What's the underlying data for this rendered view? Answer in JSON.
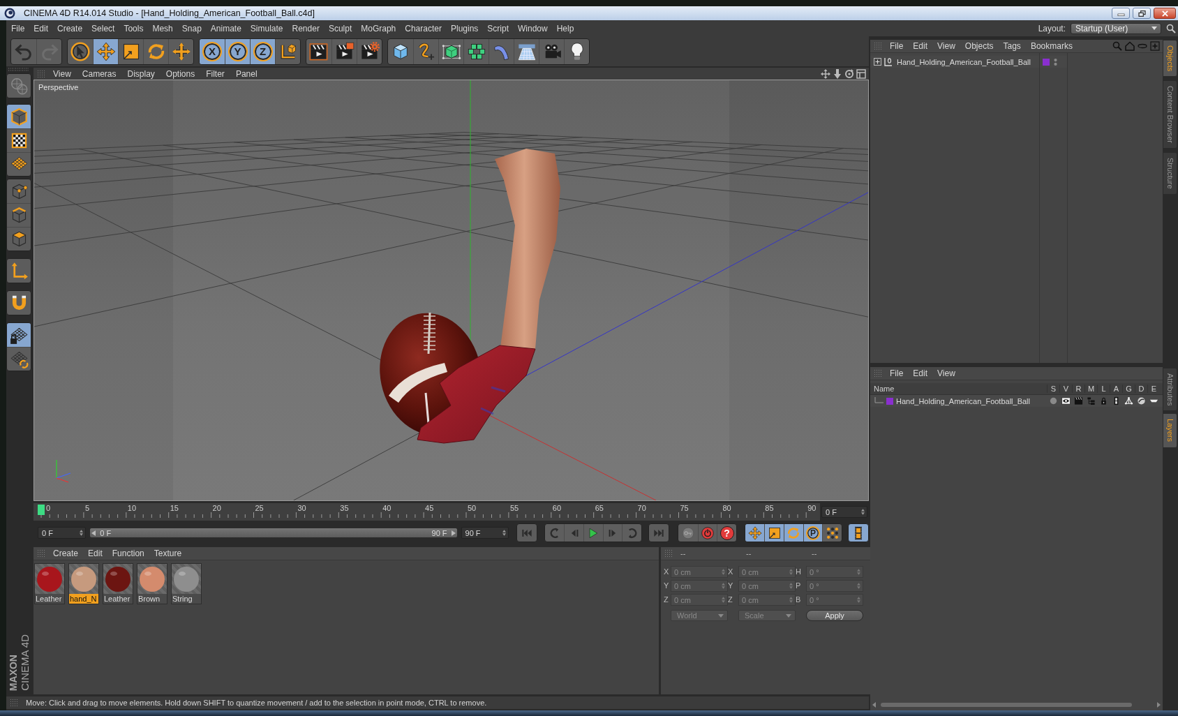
{
  "window": {
    "title": "CINEMA 4D R14.014 Studio - [Hand_Holding_American_Football_Ball.c4d]"
  },
  "menu_bar": [
    "File",
    "Edit",
    "Create",
    "Select",
    "Tools",
    "Mesh",
    "Snap",
    "Animate",
    "Simulate",
    "Render",
    "Sculpt",
    "MoGraph",
    "Character",
    "Plugins",
    "Script",
    "Window",
    "Help"
  ],
  "layout": {
    "label": "Layout:",
    "value": "Startup (User)"
  },
  "toolbar": [
    [
      {
        "kind": "undo",
        "selected": false
      },
      {
        "kind": "redo",
        "selected": false
      }
    ],
    [
      {
        "kind": "live_select",
        "selected": false
      },
      {
        "kind": "move",
        "selected": true
      },
      {
        "kind": "scale",
        "selected": false
      },
      {
        "kind": "rotate",
        "selected": false
      },
      {
        "kind": "recent_tools",
        "selected": false
      }
    ],
    [
      {
        "kind": "axis_lock",
        "label": "X",
        "selected": true
      },
      {
        "kind": "axis_lock",
        "label": "Y",
        "selected": true
      },
      {
        "kind": "axis_lock",
        "label": "Z",
        "selected": true
      },
      {
        "kind": "coordinate_system",
        "selected": false
      }
    ],
    [
      {
        "kind": "render_view",
        "selected": false
      },
      {
        "kind": "render_viewer",
        "selected": false
      },
      {
        "kind": "render_settings",
        "selected": false
      }
    ],
    [
      {
        "kind": "cube",
        "selected": false
      },
      {
        "kind": "spline",
        "selected": false
      },
      {
        "kind": "subdivision",
        "selected": false
      },
      {
        "kind": "cloner",
        "selected": false
      },
      {
        "kind": "deformer",
        "selected": false
      },
      {
        "kind": "floor",
        "selected": false
      },
      {
        "kind": "camera",
        "selected": false
      },
      {
        "kind": "light",
        "selected": false
      }
    ]
  ],
  "mode_tools": [
    [
      {
        "kind": "make_editable",
        "selected": false
      }
    ],
    [
      {
        "kind": "model",
        "selected": true
      },
      {
        "kind": "texture",
        "selected": false
      },
      {
        "kind": "workplane",
        "selected": false
      }
    ],
    [
      {
        "kind": "points",
        "selected": false
      },
      {
        "kind": "edges",
        "selected": false
      },
      {
        "kind": "polygons",
        "selected": false
      }
    ],
    [
      {
        "kind": "axis",
        "selected": false
      }
    ],
    [
      {
        "kind": "snap",
        "selected": false
      }
    ],
    [
      {
        "kind": "workplane_lock",
        "selected": true
      },
      {
        "kind": "workplane_rotate",
        "selected": false
      }
    ]
  ],
  "brand": {
    "line_1": "MAXON",
    "line_2": "CINEMA 4D"
  },
  "viewport": {
    "menu": [
      "View",
      "Cameras",
      "Display",
      "Options",
      "Filter",
      "Panel"
    ],
    "camera_label": "Perspective"
  },
  "timeline": {
    "ruler_labels": [
      "0",
      "5",
      "10",
      "15",
      "20",
      "25",
      "30",
      "35",
      "40",
      "45",
      "50",
      "55",
      "60",
      "65",
      "70",
      "75",
      "80",
      "85",
      "90"
    ],
    "playhead": {
      "level": 0
    },
    "current_frame": "0 F"
  },
  "playback": {
    "start_field": "0 F",
    "range_slider": {
      "start": {
        "label": "0 F",
        "level": 0
      },
      "end": {
        "label": "90 F",
        "level": 1
      }
    },
    "end_field": "90 F",
    "buttons": [
      [
        {
          "kind": "go_start",
          "selected": false
        }
      ],
      [
        {
          "kind": "prev_key",
          "selected": false
        },
        {
          "kind": "prev_frame",
          "selected": false
        },
        {
          "kind": "play",
          "selected": false
        },
        {
          "kind": "next_frame",
          "selected": false
        },
        {
          "kind": "next_key",
          "selected": false
        }
      ],
      [
        {
          "kind": "go_end",
          "selected": false
        }
      ],
      [
        {
          "kind": "record_keys",
          "selected": false
        },
        {
          "kind": "record",
          "selected": false
        },
        {
          "kind": "autokey",
          "label": "?",
          "selected": false
        }
      ],
      [
        {
          "kind": "key_position",
          "selected": true
        },
        {
          "kind": "key_scale",
          "selected": true
        },
        {
          "kind": "key_rotation",
          "selected": true
        },
        {
          "kind": "key_parameter",
          "label": "P",
          "selected": true
        },
        {
          "kind": "key_points",
          "selected": false
        }
      ],
      [
        {
          "kind": "timeline",
          "selected": true
        }
      ]
    ]
  },
  "materials": {
    "menu": [
      "Create",
      "Edit",
      "Function",
      "Texture"
    ],
    "items": [
      {
        "name": "Leather",
        "color": "#a8161c",
        "selected": false
      },
      {
        "name": "hand_N",
        "color": "#c69a7e",
        "selected": true
      },
      {
        "name": "Leather",
        "color": "#6c1511",
        "selected": false
      },
      {
        "name": "Brown",
        "color": "#d48b6d",
        "selected": false
      },
      {
        "name": "String",
        "color": "#8e8e8e",
        "selected": false
      }
    ]
  },
  "coordinates": {
    "headers": [
      "--",
      "--",
      "--"
    ],
    "rows": [
      [
        {
          "label": "X",
          "value": "0 cm"
        },
        {
          "label": "X",
          "value": "0 cm"
        },
        {
          "label": "H",
          "value": "0 °"
        }
      ],
      [
        {
          "label": "Y",
          "value": "0 cm"
        },
        {
          "label": "Y",
          "value": "0 cm"
        },
        {
          "label": "P",
          "value": "0 °"
        }
      ],
      [
        {
          "label": "Z",
          "value": "0 cm"
        },
        {
          "label": "Z",
          "value": "0 cm"
        },
        {
          "label": "B",
          "value": "0 °"
        }
      ]
    ],
    "dropdowns": [
      {
        "value": "World",
        "disabled": true
      },
      {
        "value": "Scale",
        "disabled": true
      }
    ],
    "apply_button": "Apply"
  },
  "status_bar": {
    "text": "Move: Click and drag to move elements. Hold down SHIFT to quantize movement / add to the selection in point mode, CTRL to remove."
  },
  "objects_panel": {
    "menu": [
      "File",
      "Edit",
      "View",
      "Objects",
      "Tags",
      "Bookmarks"
    ],
    "tree": [
      {
        "name": "Hand_Holding_American_Football_Ball",
        "expanded": false,
        "color": "#8a2fcf"
      }
    ]
  },
  "layers_panel": {
    "menu": [
      "File",
      "Edit",
      "View"
    ],
    "columns": [
      "Name",
      "S",
      "V",
      "R",
      "M",
      "L",
      "A",
      "G",
      "D",
      "E"
    ],
    "rows": [
      {
        "name": "Hand_Holding_American_Football_Ball",
        "color": "#8a2fcf",
        "toggles": [
          {
            "kind": "solo"
          },
          {
            "kind": "view"
          },
          {
            "kind": "render"
          },
          {
            "kind": "manager"
          },
          {
            "kind": "lock"
          },
          {
            "kind": "animation"
          },
          {
            "kind": "generators"
          },
          {
            "kind": "deformers"
          },
          {
            "kind": "expressions"
          }
        ]
      }
    ]
  },
  "side_tabs_top": [
    {
      "label": "Objects",
      "selected": true
    },
    {
      "label": "Content Browser",
      "selected": false
    },
    {
      "label": "Structure",
      "selected": false
    }
  ],
  "side_tabs_bottom": [
    {
      "label": "Attributes",
      "selected": false
    },
    {
      "label": "Layers",
      "selected": true
    }
  ]
}
